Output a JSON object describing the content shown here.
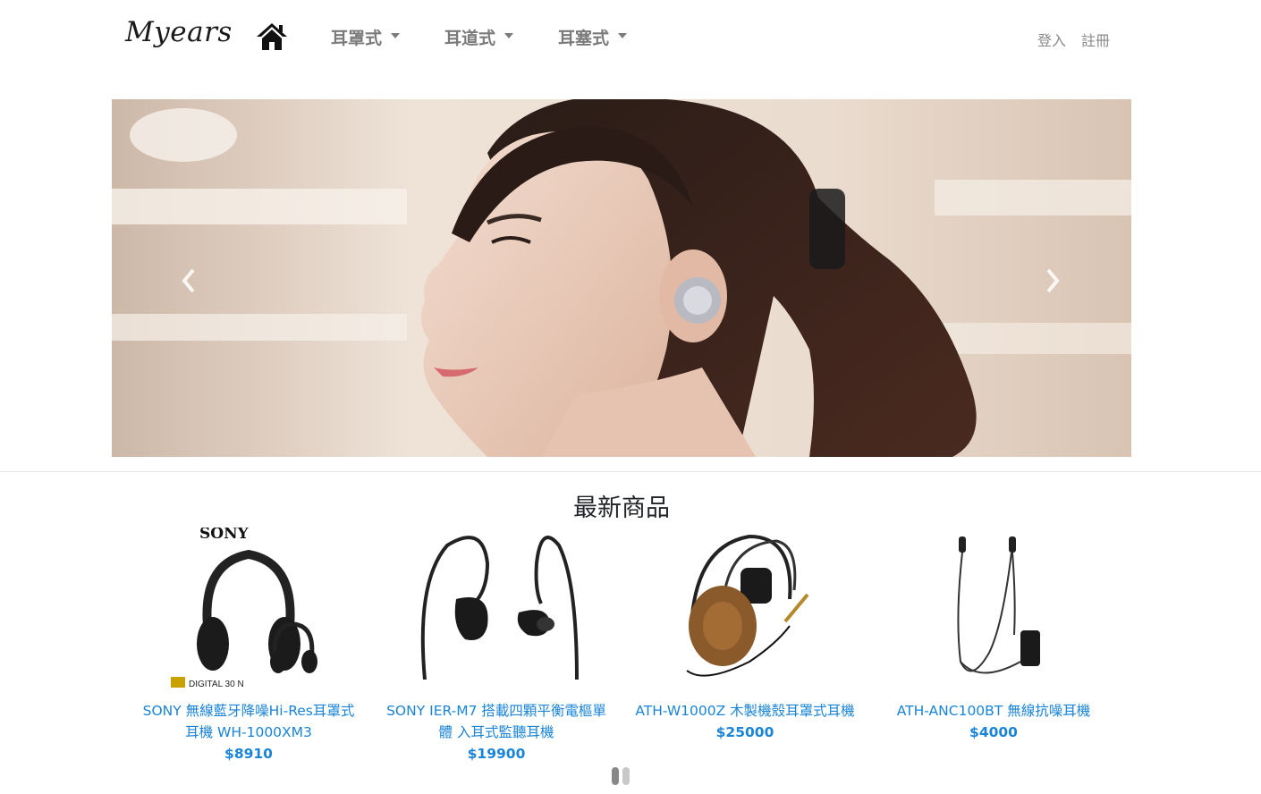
{
  "navbar": {
    "brand": "Myears",
    "menu": [
      {
        "label": "耳罩式"
      },
      {
        "label": "耳道式"
      },
      {
        "label": "耳塞式"
      }
    ],
    "login": "登入",
    "register": "註冊"
  },
  "carousel": {
    "slide_alt": "woman wearing wireless earbud",
    "prev_icon": "chevron-left-icon",
    "next_icon": "chevron-right-icon"
  },
  "products": {
    "title": "最新商品",
    "items": [
      {
        "name": "SONY 無線藍牙降噪Hi-Res耳罩式耳機 WH-1000XM3",
        "price": "$8910",
        "image_brand": "SONY",
        "image_badge": "DIGITAL 30 N"
      },
      {
        "name": "SONY IER-M7 搭載四顆平衡電樞單體 入耳式監聽耳機",
        "price": "$19900"
      },
      {
        "name": "ATH-W1000Z 木製機殼耳罩式耳機",
        "price": "$25000"
      },
      {
        "name": "ATH-ANC100BT 無線抗噪耳機",
        "price": "$4000"
      }
    ]
  },
  "colors": {
    "link": "#1a84d8",
    "nav_text": "#7a7a7a"
  }
}
